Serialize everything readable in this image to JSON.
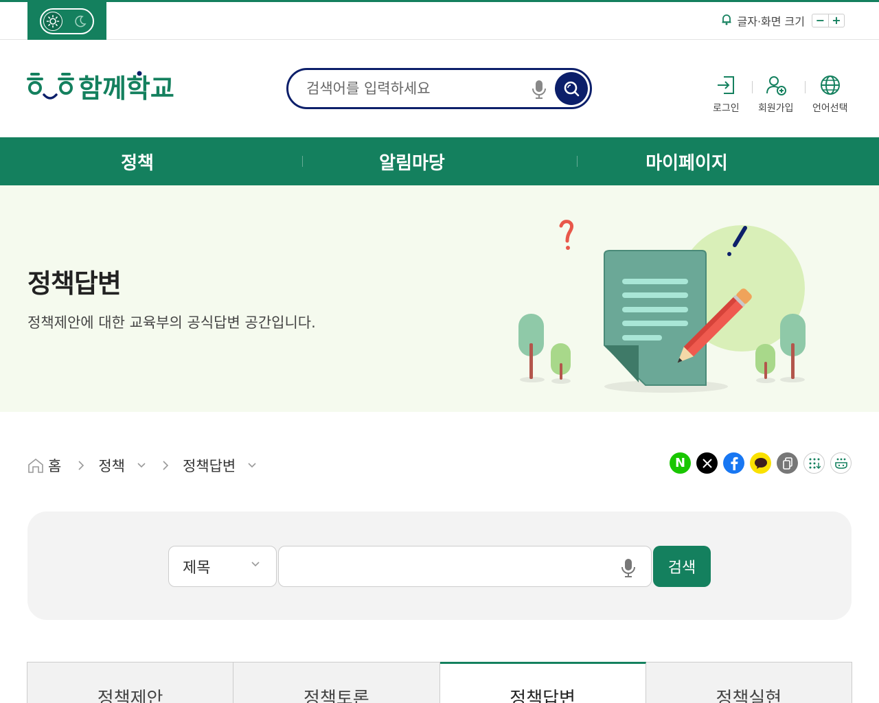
{
  "utility": {
    "font_size_label": "글자·화면 크기",
    "minus": "−",
    "plus": "+"
  },
  "header": {
    "logo_text": "함께학교",
    "search_placeholder": "검색어를 입력하세요",
    "login_label": "로그인",
    "signup_label": "회원가입",
    "language_label": "언어선택"
  },
  "gnb": [
    {
      "label": "정책"
    },
    {
      "label": "알림마당"
    },
    {
      "label": "마이페이지"
    }
  ],
  "banner": {
    "title": "정책답변",
    "description": "정책제안에 대한 교육부의 공식답변 공간입니다."
  },
  "breadcrumb": {
    "home": "홈",
    "level1": "정책",
    "level2": "정책답변"
  },
  "share": {
    "naver": "N"
  },
  "search_form": {
    "select_value": "제목",
    "keyword_value": "",
    "submit_label": "검색"
  },
  "tabs": [
    {
      "label": "정책제안"
    },
    {
      "label": "정책토론"
    },
    {
      "label": "정책답변"
    },
    {
      "label": "정책실현"
    }
  ],
  "colors": {
    "brand_green": "#14805e",
    "navy": "#0c1f6a",
    "banner_bg": "#f5faee"
  }
}
